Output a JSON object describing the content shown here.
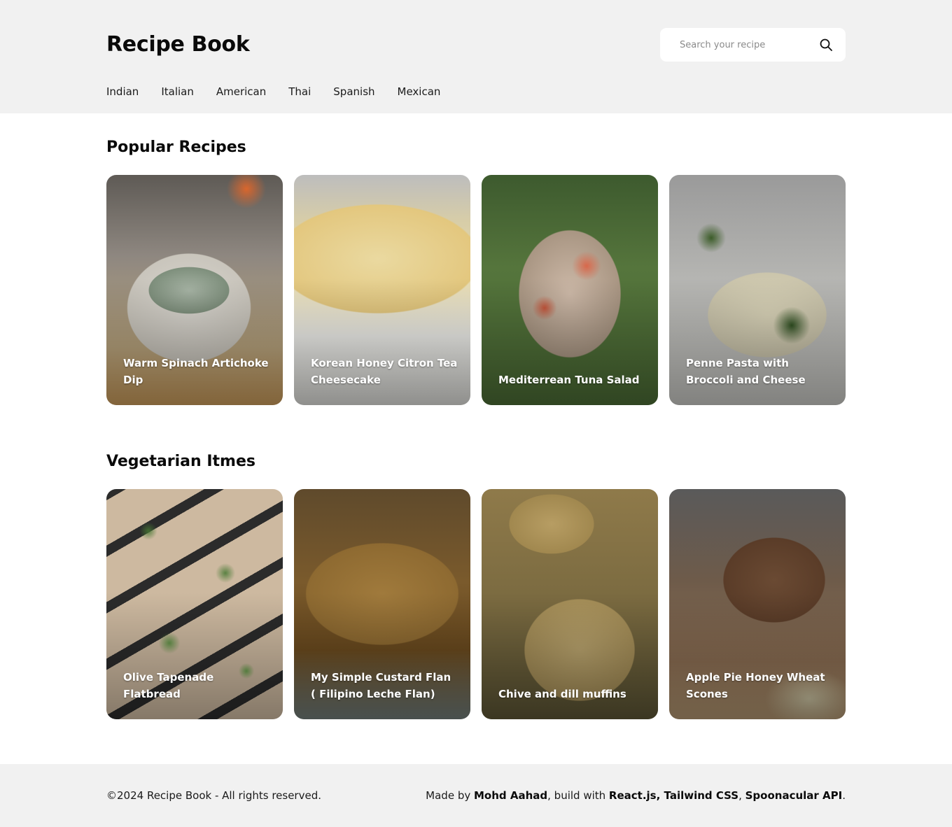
{
  "header": {
    "brand": "Recipe Book",
    "search_placeholder": "Search your recipe",
    "search_icon": "search-icon"
  },
  "nav": {
    "items": [
      "Indian",
      "Italian",
      "American",
      "Thai",
      "Spanish",
      "Mexican"
    ]
  },
  "popular": {
    "title": "Popular Recipes",
    "cards": [
      {
        "title": "Warm Spinach Artichoke Dip"
      },
      {
        "title": "Korean Honey Citron Tea Cheesecake"
      },
      {
        "title": "Mediterrean Tuna Salad"
      },
      {
        "title": "Penne Pasta with Broccoli and Cheese"
      }
    ]
  },
  "vegetarian": {
    "title": "Vegetarian Itmes",
    "cards": [
      {
        "title": "Olive Tapenade Flatbread"
      },
      {
        "title": "My Simple Custard Flan ( Filipino Leche Flan)"
      },
      {
        "title": "Chive and dill muffins"
      },
      {
        "title": "Apple Pie Honey Wheat Scones"
      }
    ]
  },
  "footer": {
    "copyright": "©2024 Recipe Book - All rights reserved.",
    "made_by_prefix": "Made by ",
    "author": "Mohd Aahad",
    "build_prefix": ", build with ",
    "stack": "React.js, Tailwind CSS",
    "comma": ", ",
    "api": "Spoonacular API",
    "period": "."
  }
}
